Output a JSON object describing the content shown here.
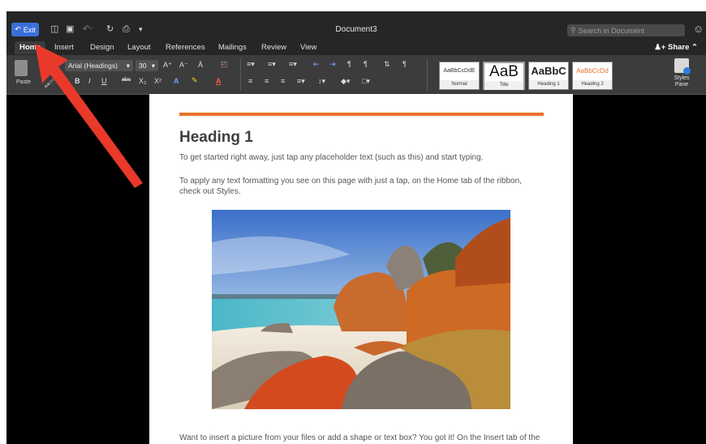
{
  "window": {
    "exit_label": "Exit",
    "doc_title": "Document3",
    "search_placeholder": "Search in Document",
    "share_label": "Share"
  },
  "tabs": [
    "Home",
    "Insert",
    "Design",
    "Layout",
    "References",
    "Mailings",
    "Review",
    "View"
  ],
  "ribbon": {
    "paste_label": "Paste",
    "font_name": "Arial (Headings)",
    "font_size": "30",
    "styles": [
      {
        "sample": "AaBbCcDdE",
        "caption": "Normal"
      },
      {
        "sample": "AaB",
        "caption": "Title"
      },
      {
        "sample": "AaBbC",
        "caption": "Heading 1"
      },
      {
        "sample": "AaBbCcDd",
        "caption": "Heading 2"
      }
    ],
    "styles_pane_label_1": "Styles",
    "styles_pane_label_2": "Pane"
  },
  "document": {
    "heading": "Heading 1",
    "para1": "To get started right away, just tap any placeholder text (such as this) and start typing.",
    "para2": "To apply any text formatting you see on this page with just a tap, on the Home tab of the ribbon, check out Styles.",
    "para3": "Want to insert a picture from your files or add a shape or text box? You got it! On the Insert tab of the ribbon, just tap the option you need."
  },
  "colors": {
    "accent_rule": "#e9722c",
    "exit_button": "#3a6fd8",
    "annotation_arrow": "#e8392a"
  }
}
